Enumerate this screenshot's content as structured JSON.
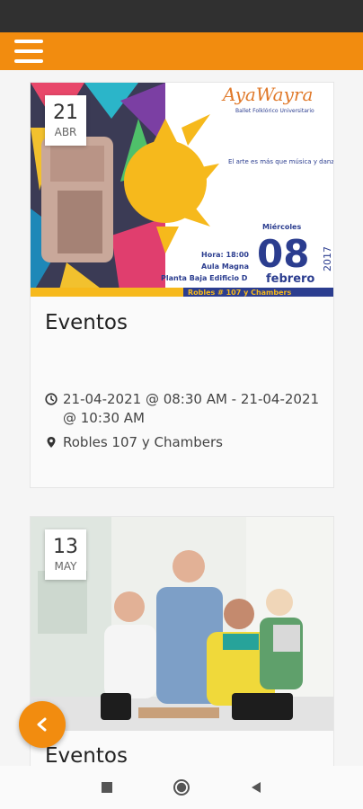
{
  "app_bar": {
    "menu_icon": "hamburger-menu-icon",
    "color": "#f28c0f"
  },
  "events": [
    {
      "day": "21",
      "month": "ABR",
      "title": "Eventos",
      "datetime": "21-04-2021 @ 08:30 AM - 21-04-2021 @ 10:30 AM",
      "location": "Robles 107 y Chambers",
      "poster": {
        "logo_text": "AyaWayra",
        "logo_subtitle": "Ballet Folklórico Universitario",
        "quote": "El arte es más que música y danza, es el real reflejo del alma.",
        "weekday": "Miércoles",
        "big_day": "08",
        "month": "febrero",
        "year": "2017",
        "time": "Hora: 18:00",
        "venue": "Aula Magna",
        "venue_detail": "Planta Baja Edificio D",
        "address_cut": "Robles # 107 y Chambers"
      }
    },
    {
      "day": "13",
      "month": "MAY",
      "title": "Eventos"
    }
  ],
  "fab": {
    "icon": "chevron-left-icon"
  },
  "nav": {
    "recents_icon": "square-icon",
    "home_icon": "circle-icon",
    "back_icon": "triangle-back-icon"
  }
}
